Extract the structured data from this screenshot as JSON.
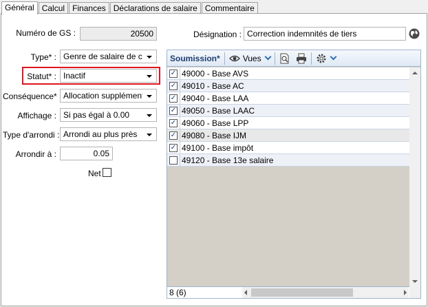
{
  "tabs": [
    {
      "label": "Général",
      "active": true
    },
    {
      "label": "Calcul",
      "active": false
    },
    {
      "label": "Finances",
      "active": false
    },
    {
      "label": "Déclarations de salaire",
      "active": false
    },
    {
      "label": "Commentaire",
      "active": false
    }
  ],
  "form": {
    "numero_label": "Numéro de GS :",
    "numero_value": "20500",
    "type_label": "Type* :",
    "type_value": "Genre de salaire de calc",
    "statut_label": "Statut* :",
    "statut_value": "Inactif",
    "consequence_label": "Conséquence* :",
    "consequence_value": "Allocation supplémentair",
    "affichage_label": "Affichage :",
    "affichage_value": "Si pas égal à 0.00",
    "arrondi_type_label": "Type d'arrondi :",
    "arrondi_type_value": "Arrondi au plus près",
    "arrondir_label": "Arrondir à :",
    "arrondir_value": "0.05",
    "net_label": "Net",
    "net_checked": false,
    "designation_label": "Désignation :",
    "designation_value": "Correction indemnités de tiers"
  },
  "grid": {
    "toolbar": {
      "soumission_label": "Soumission*",
      "vues_label": "Vues",
      "icons": [
        "eye-icon",
        "preview-icon",
        "print-icon",
        "settings-icon"
      ]
    },
    "rows": [
      {
        "label": "49000 - Base AVS",
        "checked": true
      },
      {
        "label": "49010 - Base AC",
        "checked": true
      },
      {
        "label": "49040 - Base LAA",
        "checked": true
      },
      {
        "label": "49050 - Base LAAC",
        "checked": true
      },
      {
        "label": "49060 - Base LPP",
        "checked": true
      },
      {
        "label": "49080 - Base IJM",
        "checked": true
      },
      {
        "label": "49100 - Base impôt",
        "checked": true
      },
      {
        "label": "49120 - Base 13e salaire",
        "checked": false
      }
    ],
    "status": "8 (6)"
  },
  "colors": {
    "highlight": "#e0141e",
    "accent": "#2f6fb5"
  }
}
